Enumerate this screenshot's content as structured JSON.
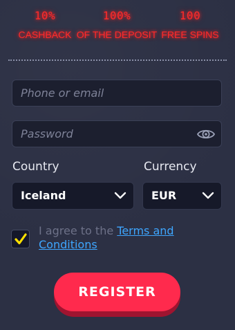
{
  "promo": {
    "items": [
      {
        "value": "10%",
        "caption": "CASHBACK"
      },
      {
        "value": "100%",
        "caption": "OF THE DEPOSIT"
      },
      {
        "value": "100",
        "caption": "FREE SPINS"
      }
    ]
  },
  "form": {
    "phone_placeholder": "Phone or email",
    "password_placeholder": "Password",
    "country_label": "Country",
    "country_value": "Iceland",
    "currency_label": "Currency",
    "currency_value": "EUR",
    "terms_prefix": "I agree to the ",
    "terms_link": "Terms and Conditions",
    "terms_checked": true,
    "register_label": "REGISTER"
  },
  "icons": {
    "password_toggle": "eye-icon",
    "select_arrow": "chevron-down-icon",
    "checkbox_mark": "check-icon"
  },
  "colors": {
    "promo_text": "#ff2a2a",
    "link": "#3ea6ff",
    "checkmark": "#ffe000",
    "register_button": "#ff2a4d"
  }
}
